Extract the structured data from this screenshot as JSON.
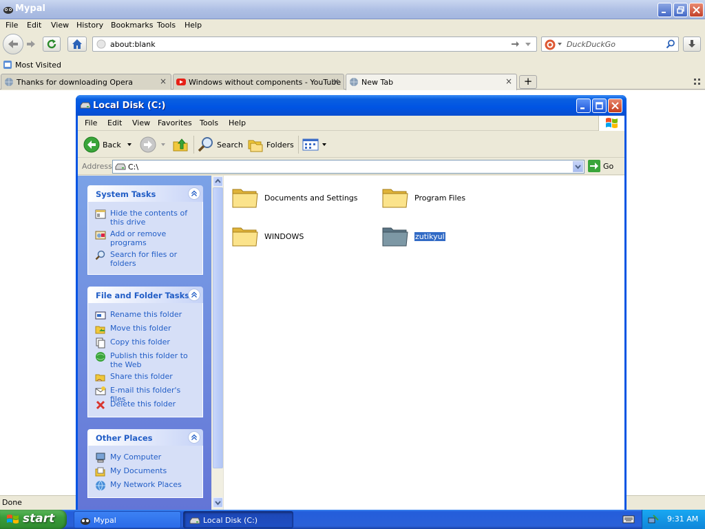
{
  "browser": {
    "title": "Mypal",
    "menu": [
      {
        "label": "File"
      },
      {
        "label": "Edit"
      },
      {
        "label": "View"
      },
      {
        "label": "History"
      },
      {
        "label": "Bookmarks"
      },
      {
        "label": "Tools"
      },
      {
        "label": "Help"
      }
    ],
    "url": "about:blank",
    "search_placeholder": "DuckDuckGo",
    "bookmarks": {
      "most_visited": "Most Visited"
    },
    "tabs": [
      {
        "label": "Thanks for downloading Opera"
      },
      {
        "label": "Windows without components - YouTube"
      },
      {
        "label": "New Tab"
      }
    ],
    "status": "Done"
  },
  "explorer": {
    "title": "Local Disk (C:)",
    "menu": [
      {
        "label": "File"
      },
      {
        "label": "Edit"
      },
      {
        "label": "View"
      },
      {
        "label": "Favorites"
      },
      {
        "label": "Tools"
      },
      {
        "label": "Help"
      }
    ],
    "toolbar": {
      "back": "Back",
      "search": "Search",
      "folders": "Folders"
    },
    "address": {
      "label": "Address",
      "value": "C:\\",
      "go": "Go"
    },
    "system_tasks": {
      "title": "System Tasks",
      "items": [
        {
          "label": "Hide the contents of this drive"
        },
        {
          "label": "Add or remove programs"
        },
        {
          "label": "Search for files or folders"
        }
      ]
    },
    "file_tasks": {
      "title": "File and Folder Tasks",
      "items": [
        {
          "label": "Rename this folder"
        },
        {
          "label": "Move this folder"
        },
        {
          "label": "Copy this folder"
        },
        {
          "label": "Publish this folder to the Web"
        },
        {
          "label": "Share this folder"
        },
        {
          "label": "E-mail this folder's files"
        },
        {
          "label": "Delete this folder"
        }
      ]
    },
    "other_places": {
      "title": "Other Places",
      "items": [
        {
          "label": "My Computer"
        },
        {
          "label": "My Documents"
        },
        {
          "label": "My Network Places"
        }
      ]
    },
    "folders": [
      {
        "name": "Documents and Settings"
      },
      {
        "name": "Program Files"
      },
      {
        "name": "WINDOWS"
      },
      {
        "name": "zutikyul"
      }
    ]
  },
  "taskbar": {
    "start": "start",
    "tasks": [
      {
        "label": "Mypal"
      },
      {
        "label": "Local Disk (C:)"
      }
    ],
    "clock": "9:31 AM"
  },
  "colors": {
    "xp_blue": "#0054e3",
    "task_link": "#215dc6",
    "start_green": "#3a9c3a",
    "selection": "#316ac5"
  }
}
